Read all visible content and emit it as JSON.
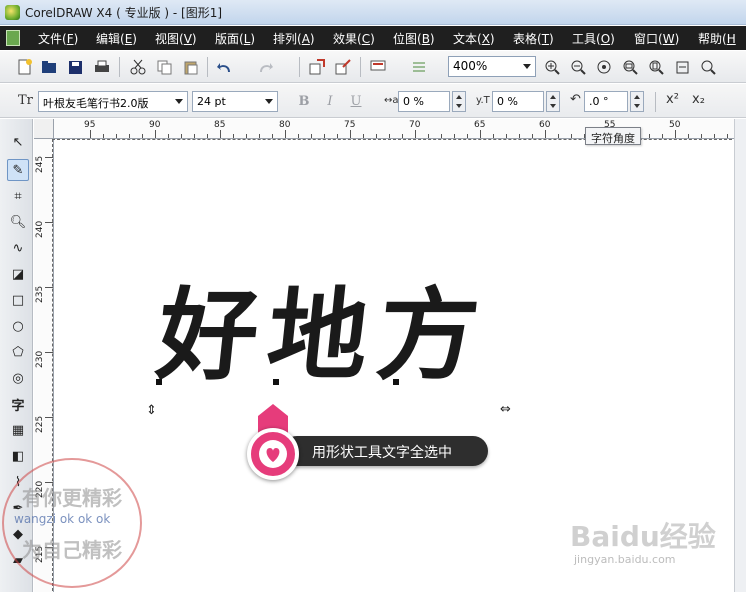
{
  "window": {
    "title": "CorelDRAW X4 ( 专业版 ) - [图形1]"
  },
  "menubar": [
    {
      "label": "文件(",
      "key": "F",
      "close": ")"
    },
    {
      "label": "编辑(",
      "key": "E",
      "close": ")"
    },
    {
      "label": "视图(",
      "key": "V",
      "close": ")"
    },
    {
      "label": "版面(",
      "key": "L",
      "close": ")"
    },
    {
      "label": "排列(",
      "key": "A",
      "close": ")"
    },
    {
      "label": "效果(",
      "key": "C",
      "close": ")"
    },
    {
      "label": "位图(",
      "key": "B",
      "close": ")"
    },
    {
      "label": "文本(",
      "key": "X",
      "close": ")"
    },
    {
      "label": "表格(",
      "key": "T",
      "close": ")"
    },
    {
      "label": "工具(",
      "key": "O",
      "close": ")"
    },
    {
      "label": "窗口(",
      "key": "W",
      "close": ")"
    },
    {
      "label": "帮助(",
      "key": "H",
      "close": ""
    }
  ],
  "toolbar": {
    "zoom": "400%"
  },
  "property_bar": {
    "font_icon": "Tr",
    "font_name": "叶根友毛笔行书2.0版",
    "font_size": "24 pt",
    "bold": "B",
    "italic": "I",
    "underline": "U",
    "kerning_value": "0 %",
    "line_spacing_value": "0 %",
    "angle_value": ".0 °",
    "superscript": "x²",
    "subscript": "x₂"
  },
  "ruler": {
    "top_ticks": [
      "95",
      "90",
      "85",
      "80",
      "75",
      "70",
      "65",
      "60",
      "55",
      "50"
    ],
    "left_ticks": [
      "245",
      "240",
      "235",
      "230",
      "225",
      "220",
      "215"
    ]
  },
  "tooltip": "字符角度",
  "canvas": {
    "art_text": "好地方",
    "callout": "用形状工具文字全选中"
  },
  "watermark": {
    "line1": "有你更精彩",
    "line2": "wangzi ok ok ok",
    "line3": "为自己精彩",
    "baidu": "Baidu经验",
    "baidu_url": "jingyan.baidu.com"
  },
  "colors": {
    "menubar_bg": "#1f1f1f",
    "callout_accent": "#e63c7b",
    "callout_bubble": "#2e2e2e"
  }
}
